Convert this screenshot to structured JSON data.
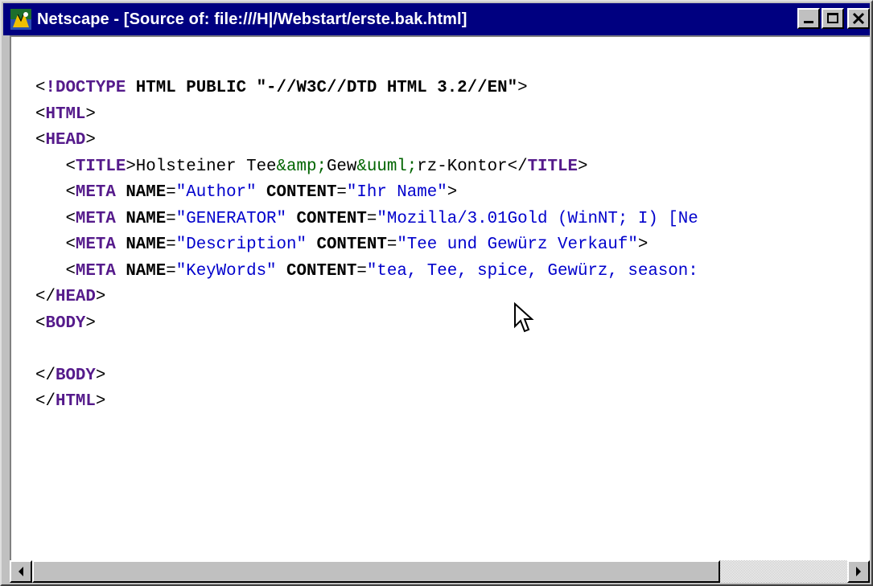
{
  "window": {
    "title": "Netscape - [Source of: file:///H|/Webstart/erste.bak.html]",
    "icon": "netscape-icon",
    "buttons": {
      "minimize": "minimize-icon",
      "maximize": "maximize-icon",
      "close": "close-icon"
    }
  },
  "source_lines": [
    [
      {
        "t": "<",
        "c": "tg"
      },
      {
        "t": "!DOCTYPE",
        "c": "kw"
      },
      {
        "t": " HTML PUBLIC ",
        "c": "at"
      },
      {
        "t": "\"-//W3C//DTD HTML 3.2//EN\"",
        "c": "at"
      },
      {
        "t": ">",
        "c": "tg"
      }
    ],
    [
      {
        "t": "<",
        "c": "tg"
      },
      {
        "t": "HTML",
        "c": "kw"
      },
      {
        "t": ">",
        "c": "tg"
      }
    ],
    [
      {
        "t": "<",
        "c": "tg"
      },
      {
        "t": "HEAD",
        "c": "kw"
      },
      {
        "t": ">",
        "c": "tg"
      }
    ],
    [
      {
        "t": "   <",
        "c": "tg"
      },
      {
        "t": "TITLE",
        "c": "kw"
      },
      {
        "t": ">Holsteiner Tee",
        "c": "tg"
      },
      {
        "t": "&amp;",
        "c": "en"
      },
      {
        "t": "Gew",
        "c": "tg"
      },
      {
        "t": "&uuml;",
        "c": "en"
      },
      {
        "t": "rz-Kontor</",
        "c": "tg"
      },
      {
        "t": "TITLE",
        "c": "kw"
      },
      {
        "t": ">",
        "c": "tg"
      }
    ],
    [
      {
        "t": "   <",
        "c": "tg"
      },
      {
        "t": "META",
        "c": "kw"
      },
      {
        "t": " NAME",
        "c": "at"
      },
      {
        "t": "=",
        "c": "tg"
      },
      {
        "t": "\"Author\"",
        "c": "vl"
      },
      {
        "t": " CONTENT",
        "c": "at"
      },
      {
        "t": "=",
        "c": "tg"
      },
      {
        "t": "\"Ihr Name\"",
        "c": "vl"
      },
      {
        "t": ">",
        "c": "tg"
      }
    ],
    [
      {
        "t": "   <",
        "c": "tg"
      },
      {
        "t": "META",
        "c": "kw"
      },
      {
        "t": " NAME",
        "c": "at"
      },
      {
        "t": "=",
        "c": "tg"
      },
      {
        "t": "\"GENERATOR\"",
        "c": "vl"
      },
      {
        "t": " CONTENT",
        "c": "at"
      },
      {
        "t": "=",
        "c": "tg"
      },
      {
        "t": "\"Mozilla/3.01Gold (WinNT; I) [Ne",
        "c": "vl"
      }
    ],
    [
      {
        "t": "   <",
        "c": "tg"
      },
      {
        "t": "META",
        "c": "kw"
      },
      {
        "t": " NAME",
        "c": "at"
      },
      {
        "t": "=",
        "c": "tg"
      },
      {
        "t": "\"Description\"",
        "c": "vl"
      },
      {
        "t": " CONTENT",
        "c": "at"
      },
      {
        "t": "=",
        "c": "tg"
      },
      {
        "t": "\"Tee und Gewürz Verkauf\"",
        "c": "vl"
      },
      {
        "t": ">",
        "c": "tg"
      }
    ],
    [
      {
        "t": "   <",
        "c": "tg"
      },
      {
        "t": "META",
        "c": "kw"
      },
      {
        "t": " NAME",
        "c": "at"
      },
      {
        "t": "=",
        "c": "tg"
      },
      {
        "t": "\"KeyWords\"",
        "c": "vl"
      },
      {
        "t": " CONTENT",
        "c": "at"
      },
      {
        "t": "=",
        "c": "tg"
      },
      {
        "t": "\"tea, Tee, spice, Gewürz, season:",
        "c": "vl"
      }
    ],
    [
      {
        "t": "</",
        "c": "tg"
      },
      {
        "t": "HEAD",
        "c": "kw"
      },
      {
        "t": ">",
        "c": "tg"
      }
    ],
    [
      {
        "t": "<",
        "c": "tg"
      },
      {
        "t": "BODY",
        "c": "kw"
      },
      {
        "t": ">",
        "c": "tg"
      }
    ],
    [
      {
        "t": "",
        "c": "tg"
      }
    ],
    [
      {
        "t": "</",
        "c": "tg"
      },
      {
        "t": "BODY",
        "c": "kw"
      },
      {
        "t": ">",
        "c": "tg"
      }
    ],
    [
      {
        "t": "</",
        "c": "tg"
      },
      {
        "t": "HTML",
        "c": "kw"
      },
      {
        "t": ">",
        "c": "tg"
      }
    ]
  ],
  "scrollbar": {
    "left_arrow": "arrow-left-icon",
    "right_arrow": "arrow-right-icon",
    "position_fraction": 0.0,
    "visible_fraction": 0.86
  },
  "cursor": "mouse-pointer-icon",
  "colors": {
    "titlebar": "#000080",
    "keyword": "#551a8b",
    "value": "#0000cc",
    "entity": "#006400",
    "chrome": "#c0c0c0"
  }
}
